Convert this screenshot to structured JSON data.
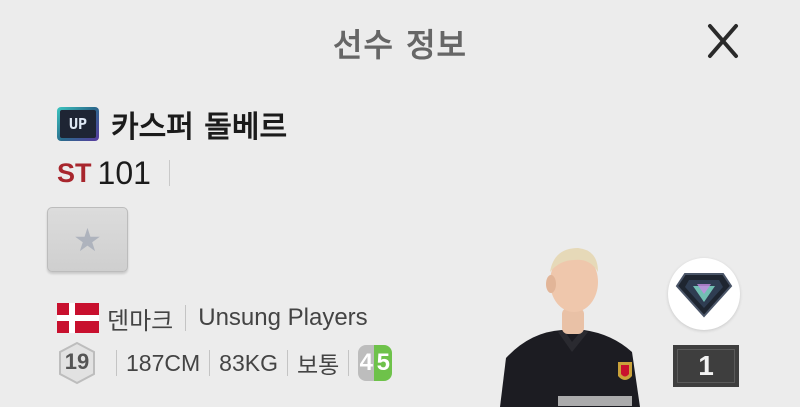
{
  "header": {
    "title": "선수 정보"
  },
  "player": {
    "badge_text": "UP",
    "name": "카스퍼 돌베르",
    "position": "ST",
    "ovr": "101",
    "nation": "덴마크",
    "season": "Unsung Players",
    "age": "19",
    "height": "187CM",
    "weight": "83KG",
    "body_type": "보통",
    "weak_foot": "4",
    "strong_foot": "5"
  },
  "level": "1",
  "colors": {
    "position": "#a8262d",
    "strong_foot": "#6ec24a",
    "flag": "#c8102e"
  }
}
